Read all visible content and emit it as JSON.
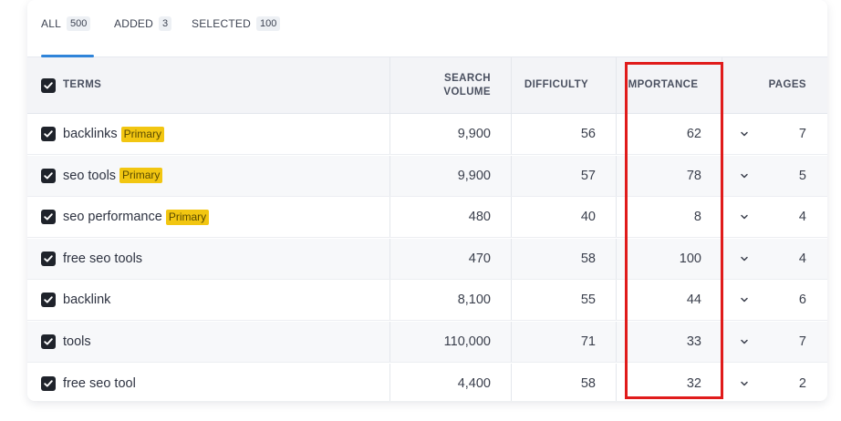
{
  "tabs": [
    {
      "label": "ALL",
      "count": "500"
    },
    {
      "label": "ADDED",
      "count": "3"
    },
    {
      "label": "SELECTED",
      "count": "100"
    }
  ],
  "headers": {
    "terms": "TERMS",
    "volume_line1": "SEARCH",
    "volume_line2": "VOLUME",
    "difficulty": "DIFFICULTY",
    "importance": "IMPORTANCE",
    "pages": "PAGES"
  },
  "rows": [
    {
      "term": "backlinks",
      "badge": "Primary",
      "volume": "9,900",
      "difficulty": "56",
      "importance": "62",
      "pages": "7"
    },
    {
      "term": "seo tools",
      "badge": "Primary",
      "volume": "9,900",
      "difficulty": "57",
      "importance": "78",
      "pages": "5"
    },
    {
      "term": "seo performance",
      "badge": "Primary",
      "volume": "480",
      "difficulty": "40",
      "importance": "8",
      "pages": "4"
    },
    {
      "term": "free seo tools",
      "badge": "",
      "volume": "470",
      "difficulty": "58",
      "importance": "100",
      "pages": "4"
    },
    {
      "term": "backlink",
      "badge": "",
      "volume": "8,100",
      "difficulty": "55",
      "importance": "44",
      "pages": "6"
    },
    {
      "term": "tools",
      "badge": "",
      "volume": "110,000",
      "difficulty": "71",
      "importance": "33",
      "pages": "7"
    },
    {
      "term": "free seo tool",
      "badge": "",
      "volume": "4,400",
      "difficulty": "58",
      "importance": "32",
      "pages": "2"
    }
  ],
  "icons": {
    "checkbox": "checkbox-checked-icon",
    "chevron": "chevron-down-icon"
  },
  "colors": {
    "accent": "#2f84d9",
    "badge": "#f2c611",
    "highlight": "#e01b1b"
  }
}
